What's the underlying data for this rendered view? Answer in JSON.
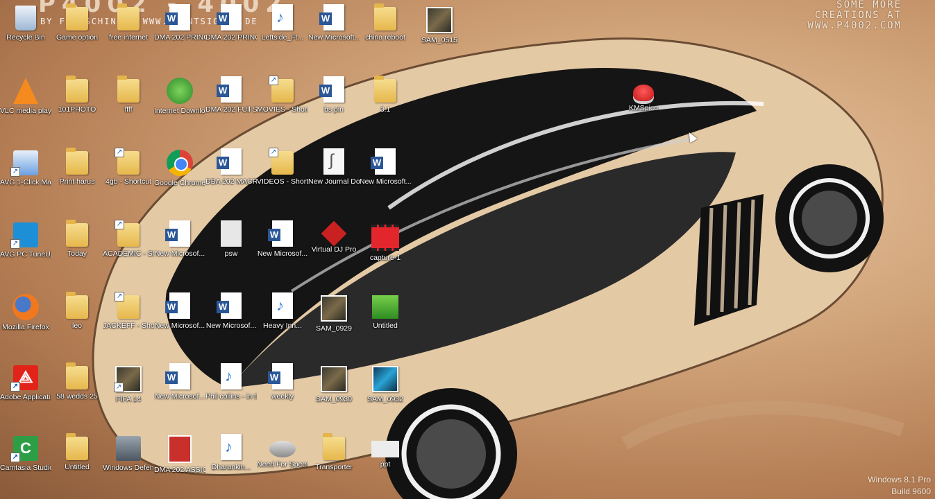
{
  "wallpaper": {
    "watermark_left": "P4002 - 4002",
    "watermark_sub": "BY F.FASCHING | WWW.FRONTSIGNAL.DE",
    "watermark_right": [
      "SOME MORE",
      "CREATIONS AT",
      "WWW.P4002.COM"
    ],
    "accent_colors": {
      "tan": "#d2a57b",
      "car_black": "#141414",
      "car_cream": "#e9d3b6"
    }
  },
  "os": {
    "edition": "Windows 8.1 Pro",
    "build": "Build 9600"
  },
  "icons": [
    {
      "label": "Recycle Bin",
      "icon": "recycle-bin-icon",
      "kind": "recycle"
    },
    {
      "label": "Game option",
      "icon": "folder-icon",
      "kind": "folder"
    },
    {
      "label": "free internet",
      "icon": "folder-icon",
      "kind": "folder"
    },
    {
      "label": "DMA 202 PRINCIPLE...",
      "icon": "word-doc-icon",
      "kind": "word"
    },
    {
      "label": "DMA 202 PRINCIPLE...",
      "icon": "word-doc-icon",
      "kind": "word"
    },
    {
      "label": "Leftside_Ft...",
      "icon": "mp3-file-icon",
      "kind": "mp3"
    },
    {
      "label": "New Microsoft...",
      "icon": "word-doc-icon",
      "kind": "word"
    },
    {
      "label": "china reboot",
      "icon": "folder-icon",
      "kind": "folder"
    },
    {
      "label": "SAM_0515",
      "icon": "photo-icon",
      "kind": "photo"
    },
    {
      "label": "VLC media player",
      "icon": "vlc-icon",
      "kind": "vlc"
    },
    {
      "label": "101PHOTO",
      "icon": "folder-icon",
      "kind": "folder"
    },
    {
      "label": "ffff",
      "icon": "folder-icon",
      "kind": "folder"
    },
    {
      "label": "Internet Downlo...",
      "icon": "idm-icon",
      "kind": "idm"
    },
    {
      "label": "DMA 202 FUll Su...",
      "icon": "word-doc-icon",
      "kind": "word"
    },
    {
      "label": "MOVIES - Shortcut",
      "icon": "folder-shortcut-icon",
      "kind": "folder-sc"
    },
    {
      "label": "bs pin",
      "icon": "word-doc-icon",
      "kind": "word"
    },
    {
      "label": "3.1",
      "icon": "folder-icon",
      "kind": "folder"
    },
    {
      "label": "KMSpico",
      "icon": "kmspico-icon",
      "kind": "kms"
    },
    {
      "label": "AVG 1-Click Maintenance",
      "icon": "avg-icon",
      "kind": "avg"
    },
    {
      "label": "Print harus",
      "icon": "folder-icon",
      "kind": "folder"
    },
    {
      "label": "4gb - Shortcut",
      "icon": "folder-shortcut-icon",
      "kind": "folder-sc"
    },
    {
      "label": "Google Chrome",
      "icon": "chrome-icon",
      "kind": "chrome"
    },
    {
      "label": "DBA 202 MACROEC...",
      "icon": "word-doc-icon",
      "kind": "word"
    },
    {
      "label": "VIDEOS - Shortcut",
      "icon": "folder-shortcut-icon",
      "kind": "folder-sc"
    },
    {
      "label": "New Journal Document",
      "icon": "journal-icon",
      "kind": "journal"
    },
    {
      "label": "New Microsoft...",
      "icon": "word-doc-icon",
      "kind": "word"
    },
    {
      "label": "AVG PC TuneUp 2014",
      "icon": "tuneup-icon",
      "kind": "tuneup"
    },
    {
      "label": "Today",
      "icon": "folder-icon",
      "kind": "folder"
    },
    {
      "label": "ACADEMIC - Shortcut",
      "icon": "folder-shortcut-icon",
      "kind": "folder-sc"
    },
    {
      "label": "New Microsof...",
      "icon": "word-doc-icon",
      "kind": "word"
    },
    {
      "label": "psw",
      "icon": "blank-file-icon",
      "kind": "grey-doc"
    },
    {
      "label": "New Microsof...",
      "icon": "word-doc-icon",
      "kind": "word"
    },
    {
      "label": "Virtual DJ Pro",
      "icon": "virtual-dj-icon",
      "kind": "virtual"
    },
    {
      "label": "capture-1",
      "icon": "video-file-icon",
      "kind": "video"
    },
    {
      "label": "Mozilla Firefox",
      "icon": "firefox-icon",
      "kind": "firefox"
    },
    {
      "label": "leo",
      "icon": "folder-icon",
      "kind": "folder"
    },
    {
      "label": "JACKEFF - Shortcut",
      "icon": "folder-shortcut-icon",
      "kind": "folder-sc"
    },
    {
      "label": "New Microsof...",
      "icon": "word-doc-icon",
      "kind": "word"
    },
    {
      "label": "New Microsof...",
      "icon": "word-doc-icon",
      "kind": "word"
    },
    {
      "label": "Heavy Inn...",
      "icon": "mp3-file-icon",
      "kind": "mp3"
    },
    {
      "label": "SAM_0929",
      "icon": "photo-icon",
      "kind": "photo"
    },
    {
      "label": "Untitled",
      "icon": "video-green-icon",
      "kind": "videogreen"
    },
    {
      "label": "Adobe Applicati...",
      "icon": "adobe-icon",
      "kind": "adobe"
    },
    {
      "label": "58 wedds 25",
      "icon": "folder-icon",
      "kind": "folder"
    },
    {
      "label": "FIFA 14",
      "icon": "fifa-icon",
      "kind": "photo-sc"
    },
    {
      "label": "New Microsof...",
      "icon": "word-doc-icon",
      "kind": "word"
    },
    {
      "label": "Phil collins - in the air t...",
      "icon": "mp3-file-icon",
      "kind": "mp3"
    },
    {
      "label": "weekly",
      "icon": "word-doc-icon",
      "kind": "word"
    },
    {
      "label": "SAM_0930",
      "icon": "photo-icon",
      "kind": "photo"
    },
    {
      "label": "SAM_0932",
      "icon": "video-thumb-icon",
      "kind": "photo-blue"
    },
    {
      "label": "Camtasia Studio 7",
      "icon": "camtasia-icon",
      "kind": "camtasia"
    },
    {
      "label": "Untitled",
      "icon": "folder-icon",
      "kind": "folder"
    },
    {
      "label": "Windows Defender",
      "icon": "defender-icon",
      "kind": "defender"
    },
    {
      "label": "DMA 202 ASSIGN...",
      "icon": "pdf-icon",
      "kind": "redpdf"
    },
    {
      "label": "Dharankin...",
      "icon": "mp3-file-icon",
      "kind": "mp3"
    },
    {
      "label": "Need For Speed H...",
      "icon": "nfs-icon",
      "kind": "nfs"
    },
    {
      "label": "Transporter",
      "icon": "folder-icon",
      "kind": "folder"
    },
    {
      "label": "ppt",
      "icon": "blank-file-icon",
      "kind": "blank"
    }
  ]
}
